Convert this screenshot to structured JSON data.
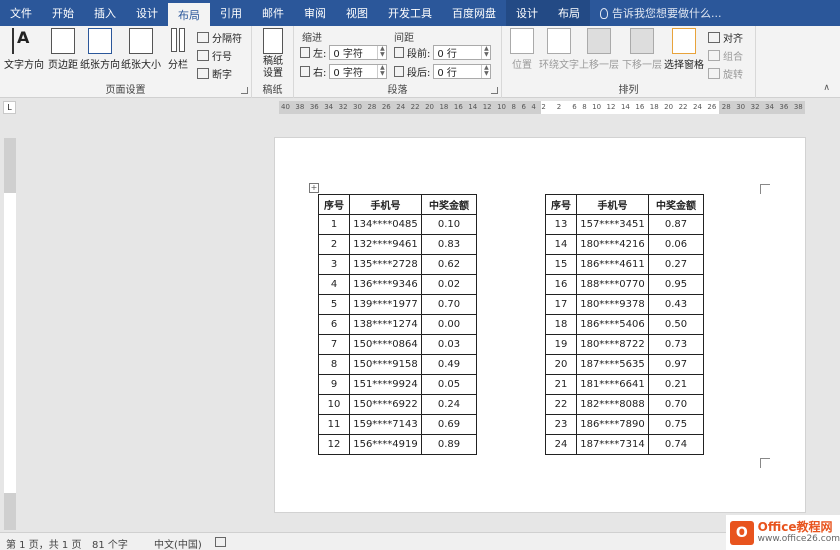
{
  "tabs": [
    {
      "label": "文件"
    },
    {
      "label": "开始"
    },
    {
      "label": "插入"
    },
    {
      "label": "设计"
    },
    {
      "label": "布局",
      "active": true
    },
    {
      "label": "引用"
    },
    {
      "label": "邮件"
    },
    {
      "label": "审阅"
    },
    {
      "label": "视图"
    },
    {
      "label": "开发工具"
    },
    {
      "label": "百度网盘"
    },
    {
      "label": "设计",
      "contextual": true
    },
    {
      "label": "布局",
      "contextual": true
    }
  ],
  "tell_me": "告诉我您想要做什么...",
  "ribbon": {
    "page_setup": {
      "label": "页面设置",
      "text_direction": "文字方向",
      "margins": "页边距",
      "orientation": "纸张方向",
      "size": "纸张大小",
      "columns": "分栏",
      "breaks": "分隔符",
      "line_numbers": "行号",
      "hyphenation": "断字"
    },
    "manuscript": {
      "label": "稿纸",
      "button": "稿纸设置"
    },
    "paragraph": {
      "label": "段落",
      "indent_title": "缩进",
      "spacing_title": "间距",
      "left_label": "左:",
      "right_label": "右:",
      "left_value": "0 字符",
      "right_value": "0 字符",
      "before_label": "段前:",
      "after_label": "段后:",
      "before_value": "0 行",
      "after_value": "0 行"
    },
    "arrange": {
      "label": "排列",
      "position": "位置",
      "wrap": "环绕文字",
      "forward": "上移一层",
      "backward": "下移一层",
      "selection_pane": "选择窗格",
      "align": "对齐",
      "group": "组合",
      "rotate": "旋转"
    }
  },
  "ruler_numbers": [
    "40",
    "38",
    "36",
    "34",
    "32",
    "30",
    "28",
    "26",
    "24",
    "22",
    "20",
    "18",
    "16",
    "14",
    "12",
    "10",
    "8",
    "6",
    "4",
    "2",
    "",
    "2",
    "",
    "6",
    "8",
    "10",
    "12",
    "14",
    "16",
    "18",
    "20",
    "22",
    "24",
    "26",
    "28",
    "30",
    "32",
    "34",
    "36",
    "38"
  ],
  "tables": [
    {
      "headers": [
        "序号",
        "手机号",
        "中奖金额"
      ],
      "rows": [
        [
          "1",
          "134****0485",
          "0.10"
        ],
        [
          "2",
          "132****9461",
          "0.83"
        ],
        [
          "3",
          "135****2728",
          "0.62"
        ],
        [
          "4",
          "136****9346",
          "0.02"
        ],
        [
          "5",
          "139****1977",
          "0.70"
        ],
        [
          "6",
          "138****1274",
          "0.00"
        ],
        [
          "7",
          "150****0864",
          "0.03"
        ],
        [
          "8",
          "150****9158",
          "0.49"
        ],
        [
          "9",
          "151****9924",
          "0.05"
        ],
        [
          "10",
          "150****6922",
          "0.24"
        ],
        [
          "11",
          "159****7143",
          "0.69"
        ],
        [
          "12",
          "156****4919",
          "0.89"
        ]
      ]
    },
    {
      "headers": [
        "序号",
        "手机号",
        "中奖金额"
      ],
      "rows": [
        [
          "13",
          "157****3451",
          "0.87"
        ],
        [
          "14",
          "180****4216",
          "0.06"
        ],
        [
          "15",
          "186****4611",
          "0.27"
        ],
        [
          "16",
          "188****0770",
          "0.95"
        ],
        [
          "17",
          "180****9378",
          "0.43"
        ],
        [
          "18",
          "186****5406",
          "0.50"
        ],
        [
          "19",
          "180****8722",
          "0.73"
        ],
        [
          "20",
          "187****5635",
          "0.97"
        ],
        [
          "21",
          "181****6641",
          "0.21"
        ],
        [
          "22",
          "182****8088",
          "0.70"
        ],
        [
          "23",
          "186****7890",
          "0.75"
        ],
        [
          "24",
          "187****7314",
          "0.74"
        ]
      ]
    }
  ],
  "status": {
    "page": "第 1 页，共 1 页",
    "words": "81 个字",
    "language": "中文(中国)"
  },
  "logo": {
    "line1": "Office教程网",
    "line2": "www.office26.com"
  },
  "colors": {
    "accent": "#2b579a",
    "logo": "#e8541e"
  }
}
